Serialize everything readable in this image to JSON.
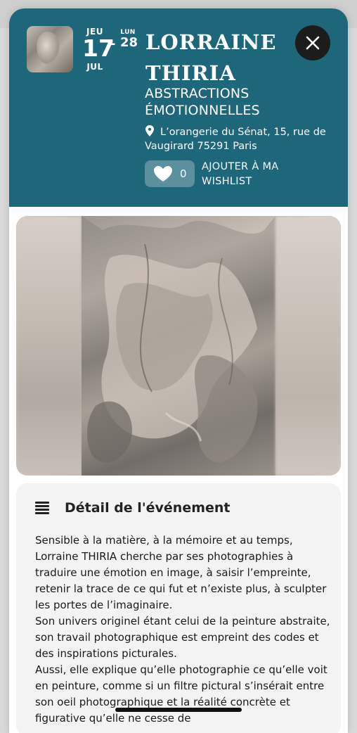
{
  "event": {
    "start": {
      "dow": "JEU",
      "day": "17",
      "month": "JUL"
    },
    "end": {
      "dow": "LUN",
      "day": "28"
    },
    "dash": "-",
    "artist": "LORRAINE THIRIA",
    "exhibition": "ABSTRACTIONS ÉMOTIONNELLES",
    "address": "L’orangerie du Sénat, 15, rue de Vaugirard 75291 Paris",
    "wishlist_count": "0",
    "wishlist_label": "AJOUTER À MA WISHLIST"
  },
  "details": {
    "heading": "Détail de l'événement",
    "paragraphs": [
      "Sensible à la matière, à la mémoire et au temps, Lorraine THIRIA cherche par ses photographies à traduire une émotion en image, à saisir l’empreinte, retenir la trace de ce qui fut et n’existe plus, à sculpter les portes de l’imaginaire.",
      "Son univers originel étant celui de la peinture abstraite, son travail photographique est empreint des codes et des inspirations picturales.",
      "Aussi, elle explique qu’elle photographie ce qu’elle voit en peinture, comme si un filtre pictural s’insérait entre son oeil photographique et la réalité concrète et figurative qu’elle ne cesse de"
    ]
  },
  "colors": {
    "header_bg": "#1e667a",
    "close_bg": "#1c1c1c",
    "card_bg": "#f3f3f3"
  },
  "icons": {
    "close": "close-icon",
    "pin": "location-pin-icon",
    "heart": "heart-icon",
    "menu": "menu-lines-icon"
  }
}
